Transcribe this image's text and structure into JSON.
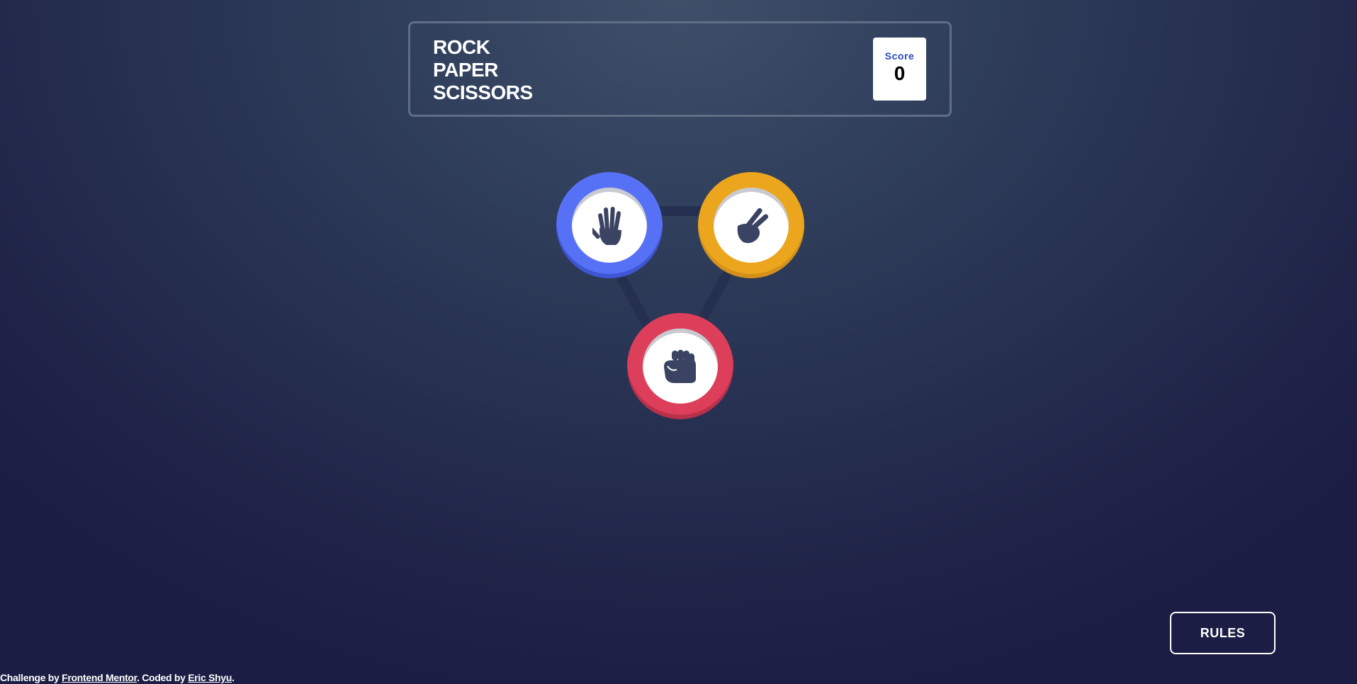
{
  "header": {
    "title_lines": [
      "Rock",
      "Paper",
      "Scissors"
    ],
    "score_label": "Score",
    "score_value": "0"
  },
  "choices": [
    {
      "id": "paper",
      "icon": "paper-hand-icon",
      "color": "#5671f5"
    },
    {
      "id": "scissors",
      "icon": "scissors-hand-icon",
      "color": "#eba61e"
    },
    {
      "id": "rock",
      "icon": "rock-fist-icon",
      "color": "#dd3f5a"
    }
  ],
  "rules_button_label": "RULES",
  "footer": {
    "prefix": "Challenge by ",
    "link1": "Frontend Mentor",
    "middle": ". Coded by ",
    "link2": "Eric Shyu",
    "suffix": "."
  },
  "colors": {
    "background_top": "#3e5069",
    "background_bottom": "#1c1d44",
    "header_border": "#606e85",
    "score_label": "#2a45c2",
    "paper": "#5671f5",
    "scissors": "#eba61e",
    "rock": "#dd3f5a",
    "icon": "#3b4363"
  }
}
